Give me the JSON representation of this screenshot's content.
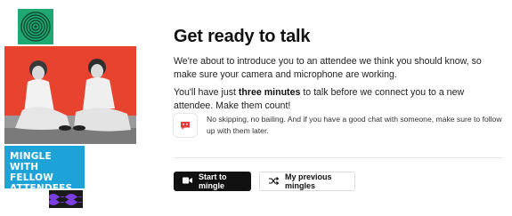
{
  "promo": {
    "banner_text": "MINGLE WITH FELLOW ATTENDEES",
    "colors": {
      "green": "#1fa871",
      "red": "#e8432f",
      "blue": "#1ea3d8",
      "purple": "#7b3fe0"
    }
  },
  "main": {
    "title": "Get ready to talk",
    "intro": "We're about to introduce you to an attendee we think you should know, so make sure your camera and microphone are working.",
    "timing_prefix": "You'll have just ",
    "timing_bold": "three minutes",
    "timing_suffix": " to talk before we connect you to a new attendee. Make them count!",
    "note_icon": "chat-alert-icon",
    "note": "No skipping, no bailing. And if you have a good chat with someone, make sure to follow up with them later."
  },
  "actions": {
    "start_label": "Start to mingle",
    "start_icon": "video-camera-icon",
    "previous_label": "My previous mingles",
    "previous_icon": "shuffle-icon"
  }
}
